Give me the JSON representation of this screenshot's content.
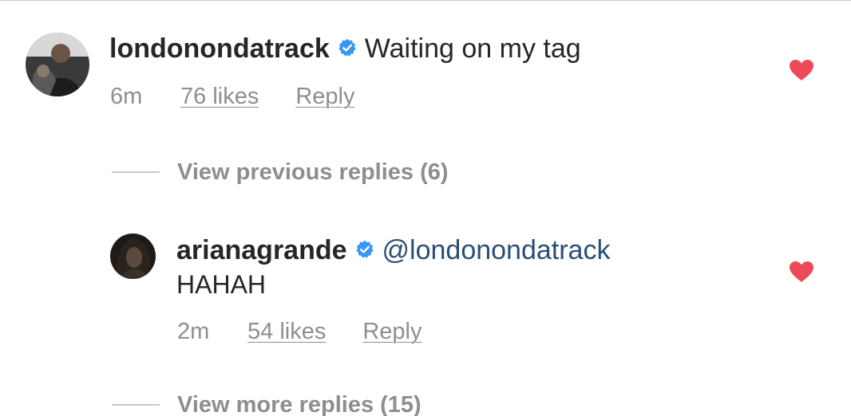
{
  "comment": {
    "username": "londonondatrack",
    "verified": true,
    "text": "Waiting on my tag",
    "time": "6m",
    "likes": "76 likes",
    "reply_label": "Reply",
    "liked": true
  },
  "view_previous": {
    "label": "View previous replies (6)"
  },
  "reply": {
    "username": "arianagrande",
    "verified": true,
    "mention": "@londonondatrack",
    "text": "HAHAH",
    "time": "2m",
    "likes": "54 likes",
    "reply_label": "Reply",
    "liked": true
  },
  "view_more": {
    "label": "View more replies (15)"
  },
  "colors": {
    "heart": "#ed4956",
    "verified": "#3897f0",
    "mention": "#2b4e74",
    "meta_text": "#8e8e8e"
  }
}
